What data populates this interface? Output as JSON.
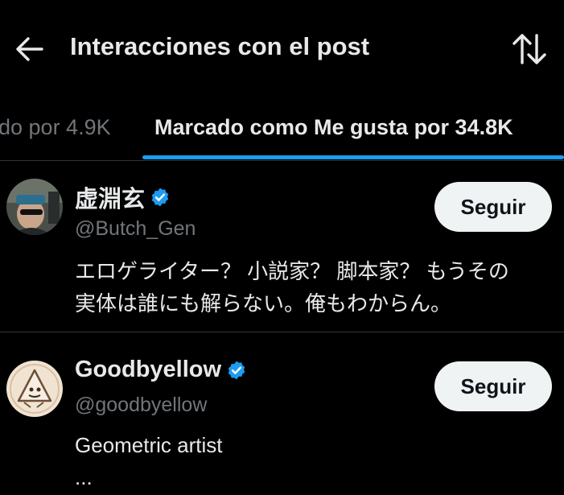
{
  "header": {
    "title": "Interacciones con el post",
    "back_icon": "arrow-left-icon",
    "sort_icon": "sort-arrows-icon"
  },
  "tabs": [
    {
      "label": "do por 4.9K",
      "active": false
    },
    {
      "label": "Marcado como Me gusta por 34.8K",
      "active": true
    }
  ],
  "colors": {
    "background": "#000000",
    "text": "#e7e9ea",
    "muted": "#71767b",
    "accent": "#1d9bf0",
    "button_bg": "#eff3f4",
    "button_text": "#0f1419"
  },
  "users": [
    {
      "name": "虚淵玄",
      "handle": "@Butch_Gen",
      "verified": true,
      "follow_label": "Seguir",
      "bio_lines": [
        "エロゲライター？ 小説家？ 脚本家？ もうその",
        "実体は誰にも解らない。俺もわからん。"
      ]
    },
    {
      "name": "Goodbyellow",
      "handle": "@goodbyellow",
      "verified": true,
      "follow_label": "Seguir",
      "bio_lines": [
        "Geometric artist",
        "..."
      ]
    }
  ]
}
